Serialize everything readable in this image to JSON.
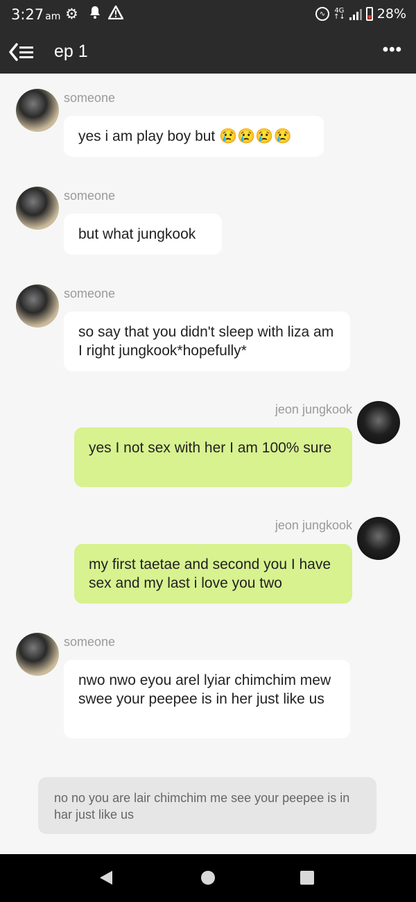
{
  "status_bar": {
    "time": "3:27",
    "ampm": "am",
    "network": "4G",
    "battery": "28%",
    "battery_level": 0.28
  },
  "header": {
    "title": "ep 1",
    "more": "•••"
  },
  "messages": [
    {
      "sender": "someone",
      "text": "yes i am play boy but 😢😢😢😢",
      "side": "left"
    },
    {
      "sender": "someone",
      "text": "but what jungkook",
      "side": "left"
    },
    {
      "sender": "someone",
      "text": "so  say that you didn't sleep with liza am I right  jungkook*hopefully*",
      "side": "left"
    },
    {
      "sender": "jeon jungkook",
      "text": "yes I not sex with her I am 100% sure",
      "side": "right"
    },
    {
      "sender": "jeon jungkook",
      "text": "my first taetae and second you I have sex and my last i love you two",
      "side": "right"
    },
    {
      "sender": "someone",
      "text": "nwo nwo eyou arel lyiar chimchim mew swee your peepee is in her just like us",
      "side": "left"
    }
  ],
  "note": {
    "text": "no no you are lair chimchim me see your peepee is in har just like us"
  },
  "colors": {
    "bar": "#2b2b2b",
    "background": "#f6f6f6",
    "bubble_left": "#ffffff",
    "bubble_right": "#d7f28f"
  }
}
